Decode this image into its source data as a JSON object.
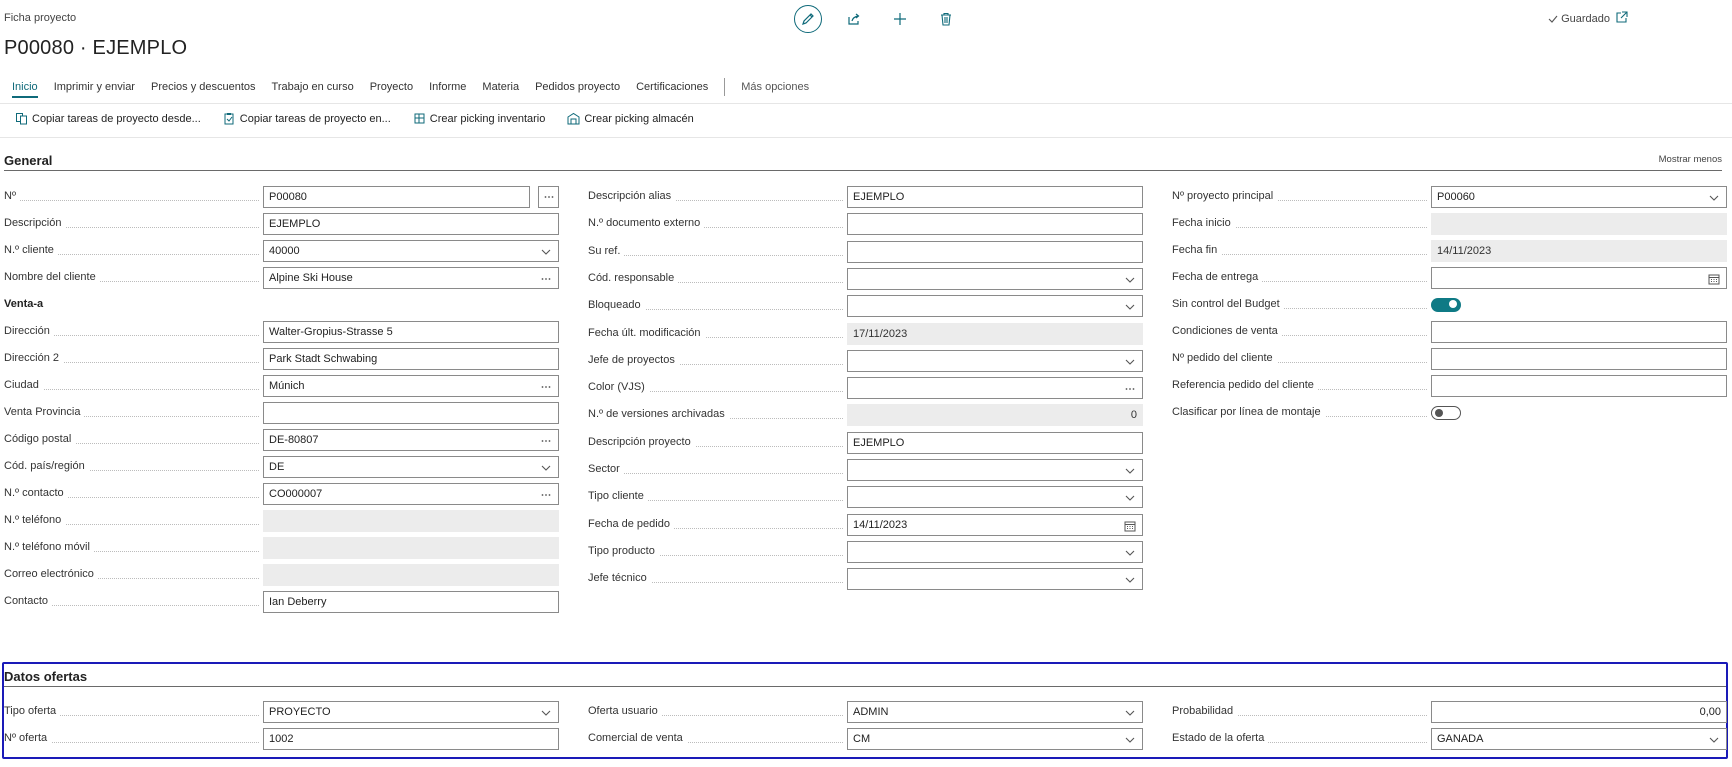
{
  "page": {
    "type_label": "Ficha proyecto",
    "title": "P00080 · EJEMPLO",
    "saved_label": "Guardado"
  },
  "tabs": [
    "Inicio",
    "Imprimir y enviar",
    "Precios y descuentos",
    "Trabajo en curso",
    "Proyecto",
    "Informe",
    "Materia",
    "Pedidos proyecto",
    "Certificaciones"
  ],
  "more_tab": "Más opciones",
  "actions": [
    "Copiar tareas de proyecto desde...",
    "Copiar tareas de proyecto en...",
    "Crear picking inventario",
    "Crear picking almacén"
  ],
  "general": {
    "title": "General",
    "show_less": "Mostrar menos",
    "col1": [
      {
        "label": "Nº",
        "value": "P00080",
        "kind": "text-ellipsis"
      },
      {
        "label": "Descripción",
        "value": "EJEMPLO",
        "kind": "text"
      },
      {
        "label": "N.º cliente",
        "value": "40000",
        "kind": "dropdown"
      },
      {
        "label": "Nombre del cliente",
        "value": "Alpine Ski House",
        "kind": "lookup"
      },
      {
        "label": "Venta-a",
        "value": "",
        "kind": "group"
      },
      {
        "label": "Dirección",
        "value": "Walter-Gropius-Strasse 5",
        "kind": "text"
      },
      {
        "label": "Dirección 2",
        "value": "Park Stadt Schwabing",
        "kind": "text"
      },
      {
        "label": "Ciudad",
        "value": "Múnich",
        "kind": "lookup"
      },
      {
        "label": "Venta Provincia",
        "value": "",
        "kind": "text"
      },
      {
        "label": "Código postal",
        "value": "DE-80807",
        "kind": "lookup"
      },
      {
        "label": "Cód. país/región",
        "value": "DE",
        "kind": "dropdown"
      },
      {
        "label": "N.º contacto",
        "value": "CO000007",
        "kind": "lookup"
      },
      {
        "label": "N.º teléfono",
        "value": "",
        "kind": "readonly"
      },
      {
        "label": "N.º teléfono móvil",
        "value": "",
        "kind": "readonly"
      },
      {
        "label": "Correo electrónico",
        "value": "",
        "kind": "readonly"
      },
      {
        "label": "Contacto",
        "value": "Ian Deberry",
        "kind": "text"
      }
    ],
    "col2": [
      {
        "label": "Descripción alias",
        "value": "EJEMPLO",
        "kind": "text"
      },
      {
        "label": "N.º documento externo",
        "value": "",
        "kind": "text"
      },
      {
        "label": "Su ref.",
        "value": "",
        "kind": "text"
      },
      {
        "label": "Cód. responsable",
        "value": "",
        "kind": "dropdown"
      },
      {
        "label": "Bloqueado",
        "value": "",
        "kind": "dropdown"
      },
      {
        "label": "Fecha últ. modificación",
        "value": "17/11/2023",
        "kind": "readonly"
      },
      {
        "label": "Jefe de proyectos",
        "value": "",
        "kind": "dropdown"
      },
      {
        "label": "Color (VJS)",
        "value": "",
        "kind": "lookup"
      },
      {
        "label": "N.º de versiones archivadas",
        "value": "0",
        "kind": "readonly-num"
      },
      {
        "label": "Descripción proyecto",
        "value": "EJEMPLO",
        "kind": "text"
      },
      {
        "label": "Sector",
        "value": "",
        "kind": "dropdown"
      },
      {
        "label": "Tipo cliente",
        "value": "",
        "kind": "dropdown"
      },
      {
        "label": "Fecha de pedido",
        "value": "14/11/2023",
        "kind": "date"
      },
      {
        "label": "Tipo producto",
        "value": "",
        "kind": "dropdown"
      },
      {
        "label": "Jefe técnico",
        "value": "",
        "kind": "dropdown"
      }
    ],
    "col3": [
      {
        "label": "Nº proyecto principal",
        "value": "P00060",
        "kind": "dropdown"
      },
      {
        "label": "Fecha inicio",
        "value": "",
        "kind": "readonly"
      },
      {
        "label": "Fecha fin",
        "value": "14/11/2023",
        "kind": "readonly"
      },
      {
        "label": "Fecha de entrega",
        "value": "",
        "kind": "date"
      },
      {
        "label": "Sin control del Budget",
        "value": "on",
        "kind": "toggle"
      },
      {
        "label": "Condiciones de venta",
        "value": "",
        "kind": "text"
      },
      {
        "label": "Nº pedido del cliente",
        "value": "",
        "kind": "text"
      },
      {
        "label": "Referencia pedido del cliente",
        "value": "",
        "kind": "text"
      },
      {
        "label": "Clasificar por línea de montaje",
        "value": "off",
        "kind": "toggle"
      }
    ]
  },
  "offers": {
    "title": "Datos ofertas",
    "col1": [
      {
        "label": "Tipo oferta",
        "value": "PROYECTO",
        "kind": "dropdown"
      },
      {
        "label": "Nº oferta",
        "value": "1002",
        "kind": "text"
      }
    ],
    "col2": [
      {
        "label": "Oferta usuario",
        "value": "ADMIN",
        "kind": "dropdown"
      },
      {
        "label": "Comercial de venta",
        "value": "CM",
        "kind": "dropdown"
      }
    ],
    "col3": [
      {
        "label": "Probabilidad",
        "value": "0,00",
        "kind": "num"
      },
      {
        "label": "Estado de la oferta",
        "value": "GANADA",
        "kind": "dropdown"
      }
    ]
  },
  "colors": {
    "accent": "#0f6a7a",
    "focus_border": "#1a1ab8"
  }
}
